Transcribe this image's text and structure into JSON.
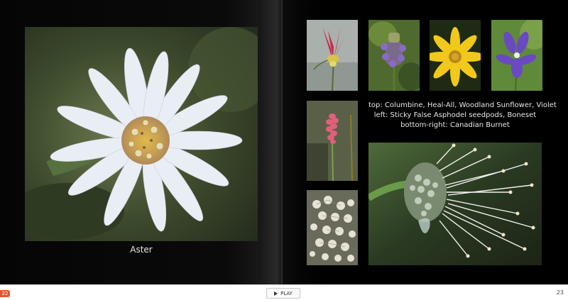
{
  "left_page": {
    "photo_subject": "aster-flower",
    "caption": "Aster"
  },
  "right_page": {
    "caption_lines": [
      "top: Columbine, Heal-All, Woodland Sunflower, Violet",
      "left: Sticky False Asphodel seedpods, Boneset",
      "bottom-right: Canadian Burnet"
    ]
  },
  "footer": {
    "left_page_number": "22",
    "play_label": "PLAY",
    "right_page_number": "23"
  },
  "colors": {
    "page_badge": "#e8552a",
    "book_background": "#000000"
  }
}
